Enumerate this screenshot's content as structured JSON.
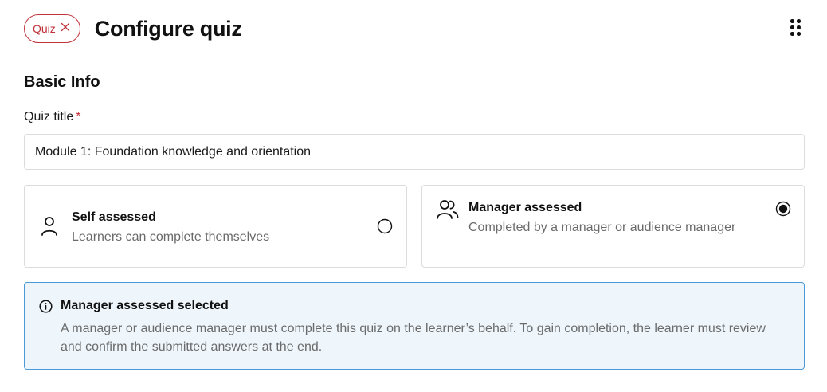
{
  "header": {
    "tag_label": "Quiz",
    "tag_close_icon": "close-icon",
    "title": "Configure quiz",
    "menu_icon": "kebab-menu-icon"
  },
  "basic_info": {
    "section_title": "Basic Info",
    "quiz_title_label": "Quiz title",
    "required_marker": "*",
    "quiz_title_value": "Module 1: Foundation knowledge and orientation"
  },
  "assessment_options": [
    {
      "title": "Self assessed",
      "description": "Learners can complete themselves",
      "icon": "person-icon",
      "selected": false
    },
    {
      "title": "Manager assessed",
      "description": "Completed by a manager or audience manager",
      "icon": "people-icon",
      "selected": true
    }
  ],
  "notice": {
    "icon": "info-icon",
    "title": "Manager assessed selected",
    "body": "A manager or audience manager must complete this quiz on the learner’s behalf. To gain completion, the learner must review and confirm the submitted answers at the end."
  },
  "colors": {
    "accent_red": "#c0323a",
    "info_border": "#4a9ad8",
    "info_background": "#eef6fc",
    "border_gray": "#dcdcdc",
    "muted_text": "#6b6b6b"
  }
}
